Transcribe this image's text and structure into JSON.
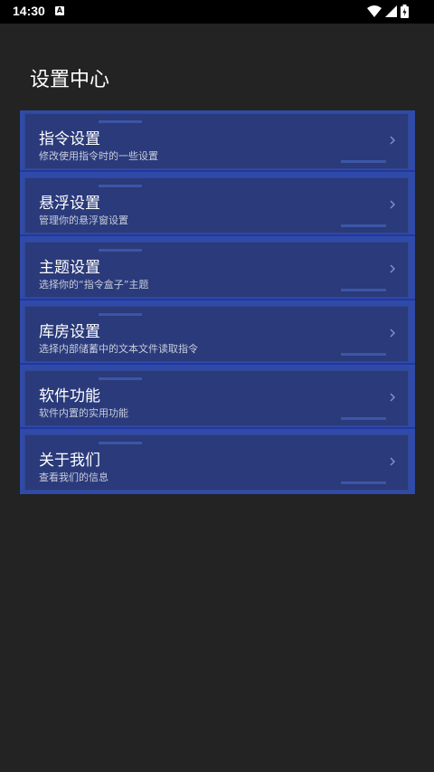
{
  "status": {
    "time": "14:30",
    "notif_letter": "A"
  },
  "header": {
    "title": "设置中心"
  },
  "menu": {
    "items": [
      {
        "title": "指令设置",
        "subtitle": "修改使用指令时的一些设置"
      },
      {
        "title": "悬浮设置",
        "subtitle": "管理你的悬浮窗设置"
      },
      {
        "title": "主题设置",
        "subtitle": "选择你的“指令盒子”主题"
      },
      {
        "title": "库房设置",
        "subtitle": "选择内部储蓄中的文本文件读取指令"
      },
      {
        "title": "软件功能",
        "subtitle": "软件内置的实用功能"
      },
      {
        "title": "关于我们",
        "subtitle": "查看我们的信息"
      }
    ]
  },
  "colors": {
    "background": "#232323",
    "panel": "#2f4aa8",
    "card": "#2a3a7a"
  },
  "icons": {
    "wifi": "wifi-icon",
    "signal": "signal-icon",
    "battery": "battery-icon",
    "chevron": "chevron-right-icon"
  }
}
